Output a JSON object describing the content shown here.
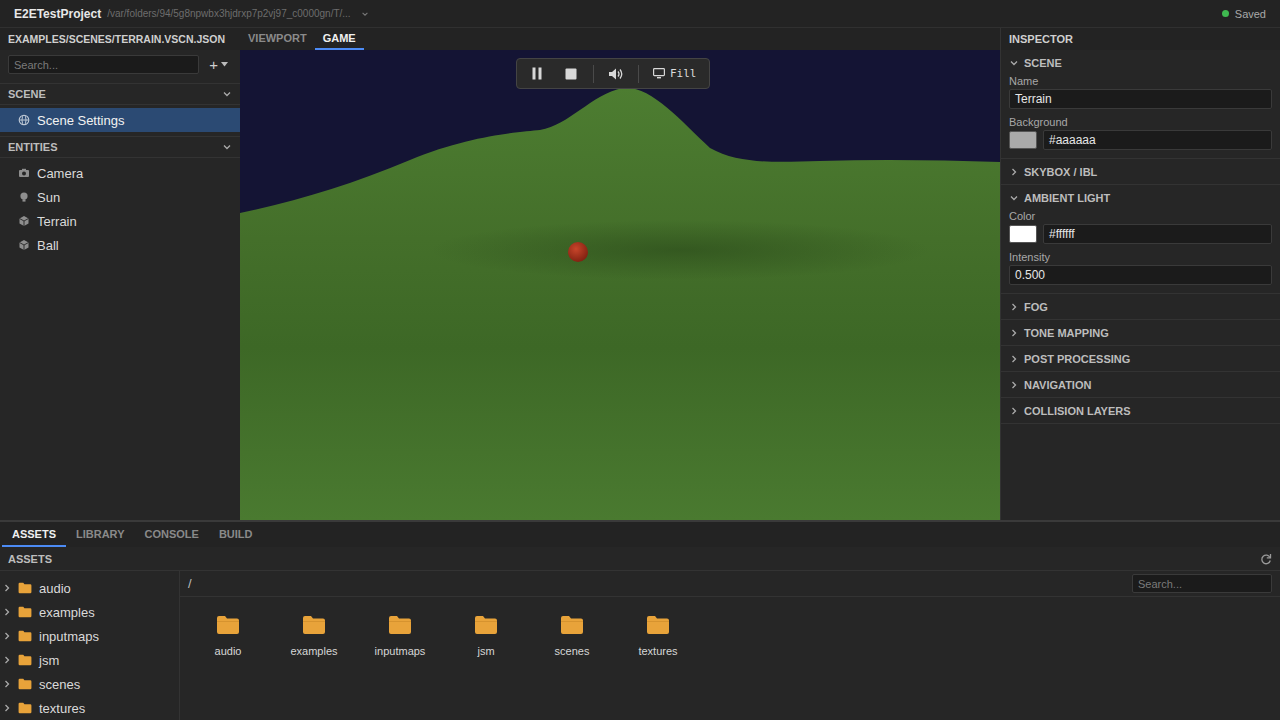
{
  "window": {
    "title": "E2ETestProject",
    "path": "/var/folders/94/5g8npwbx3hjdrxp7p2vj97_c0000gn/T/...",
    "status": "Saved"
  },
  "document": {
    "label": "EXAMPLES/SCENES/TERRAIN.VSCN.JSON"
  },
  "view_tabs": [
    {
      "label": "VIEWPORT",
      "selected": false
    },
    {
      "label": "GAME",
      "selected": true
    }
  ],
  "hierarchy": {
    "search": {
      "placeholder": "Search..."
    },
    "add_button": "+",
    "sections": [
      {
        "title": "SCENE",
        "expanded": true,
        "items": [
          {
            "label": "Scene Settings",
            "kind": "settings",
            "selected": true
          }
        ]
      },
      {
        "title": "ENTITIES",
        "expanded": true,
        "items": [
          {
            "label": "Camera",
            "kind": "camera",
            "selected": false
          },
          {
            "label": "Sun",
            "kind": "light",
            "selected": false
          },
          {
            "label": "Terrain",
            "kind": "mesh",
            "selected": false
          },
          {
            "label": "Ball",
            "kind": "mesh",
            "selected": false
          }
        ]
      }
    ]
  },
  "game_toolbar": {
    "scale_mode": "Fill"
  },
  "inspector": {
    "title": "INSPECTOR",
    "sections": [
      {
        "title": "SCENE",
        "expanded": true,
        "fields": [
          {
            "label": "Name",
            "kind": "text",
            "value": "Terrain"
          },
          {
            "label": "Background",
            "kind": "color",
            "value": "#aaaaaa",
            "color": "#aaaaaa"
          }
        ]
      },
      {
        "title": "SKYBOX / IBL",
        "expanded": false,
        "fields": []
      },
      {
        "title": "AMBIENT LIGHT",
        "expanded": true,
        "fields": [
          {
            "label": "Color",
            "kind": "color",
            "value": "#ffffff",
            "color": "#ffffff"
          },
          {
            "label": "Intensity",
            "kind": "text",
            "value": "0.500"
          }
        ]
      },
      {
        "title": "FOG",
        "expanded": false,
        "fields": []
      },
      {
        "title": "TONE MAPPING",
        "expanded": false,
        "fields": []
      },
      {
        "title": "POST PROCESSING",
        "expanded": false,
        "fields": []
      },
      {
        "title": "NAVIGATION",
        "expanded": false,
        "fields": []
      },
      {
        "title": "COLLISION LAYERS",
        "expanded": false,
        "fields": []
      }
    ]
  },
  "bottom_tabs": [
    {
      "label": "ASSETS",
      "selected": true
    },
    {
      "label": "LIBRARY",
      "selected": false
    },
    {
      "label": "CONSOLE",
      "selected": false
    },
    {
      "label": "BUILD",
      "selected": false
    }
  ],
  "assets": {
    "title": "ASSETS",
    "path": "/",
    "search": {
      "placeholder": "Search..."
    },
    "tree": [
      {
        "label": "audio",
        "expanded": false
      },
      {
        "label": "examples",
        "expanded": false
      },
      {
        "label": "inputmaps",
        "expanded": false
      },
      {
        "label": "jsm",
        "expanded": false
      },
      {
        "label": "scenes",
        "expanded": false
      },
      {
        "label": "textures",
        "expanded": false
      }
    ],
    "folders": [
      {
        "label": "audio"
      },
      {
        "label": "examples"
      },
      {
        "label": "inputmaps"
      },
      {
        "label": "jsm"
      },
      {
        "label": "scenes"
      },
      {
        "label": "textures"
      }
    ]
  }
}
